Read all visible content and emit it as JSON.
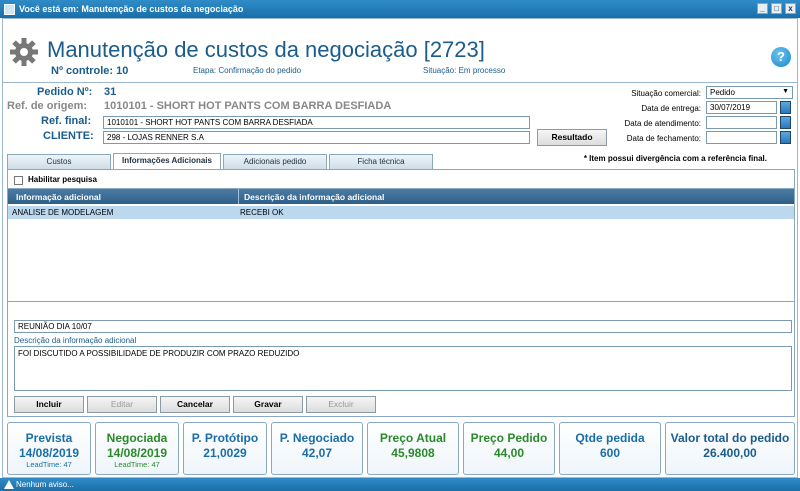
{
  "window": {
    "title": "Você está em: Manutenção de custos da negociação",
    "controls": [
      "_",
      "□",
      "x"
    ]
  },
  "header": {
    "title": "Manutenção de custos da negociação [2723]",
    "controle_label": "Nº controle:",
    "controle_value": "10",
    "etapa_label": "Etapa:",
    "etapa_value": "Confirmação do pedido",
    "situacao_label": "Situação:",
    "situacao_value": "Em processo"
  },
  "form": {
    "pedido_label": "Pedido Nº:",
    "pedido_value": "31",
    "ref_origem_label": "Ref. de origem:",
    "ref_origem_value": "1010101 - SHORT HOT PANTS COM BARRA DESFIADA",
    "ref_final_label": "Ref. final:",
    "ref_final_value": "1010101 - SHORT HOT PANTS COM BARRA DESFIADA",
    "cliente_label": "CLIENTE:",
    "cliente_value": "298 - LOJAS RENNER S.A",
    "resultado_button": "Resultado",
    "situacao_comercial_label": "Situação comercial:",
    "situacao_comercial_value": "Pedido",
    "data_entrega_label": "Data de entrega:",
    "data_entrega_value": "30/07/2019",
    "data_atendimento_label": "Data de atendimento:",
    "data_atendimento_value": "",
    "data_fechamento_label": "Data de fechamento:",
    "data_fechamento_value": ""
  },
  "tabs": [
    {
      "label": "Custos"
    },
    {
      "label": "Informações Adicionais"
    },
    {
      "label": "Adicionais pedido"
    },
    {
      "label": "Ficha técnica"
    }
  ],
  "note": "* Item possui divergência com a referência final.",
  "panel": {
    "habilitar_label": "Habilitar pesquisa",
    "columns": [
      "Informação adicional",
      "Descrição da informação adicional"
    ],
    "rows": [
      {
        "info": "ANALISE DE MODELAGEM",
        "desc": "RECEBI OK"
      }
    ],
    "info_input_value": "REUNIÃO DIA 10/07",
    "desc_label": "Descrição da informação adicional",
    "desc_value": "FOI DISCUTIDO A POSSIBILIDADE DE PRODUZIR COM PRAZO REDUZIDO",
    "buttons": [
      "Incluir",
      "Editar",
      "Cancelar",
      "Gravar",
      "Excluir"
    ]
  },
  "cards": {
    "prevista_title": "Prevista",
    "prevista_value": "14/08/2019",
    "prevista_lead": "LeadTime: 47",
    "negociada_title": "Negociada",
    "negociada_value": "14/08/2019",
    "negociada_lead": "LeadTime: 47",
    "prototipo_title": "P. Protótipo",
    "prototipo_value": "21,0029",
    "negociado_title": "P. Negociado",
    "negociado_value": "42,07",
    "preco_atual_title": "Preço Atual",
    "preco_atual_value": "45,9808",
    "preco_pedido_title": "Preço Pedido",
    "preco_pedido_value": "44,00",
    "qtde_title": "Qtde pedida",
    "qtde_value": "600",
    "valor_total_title": "Valor total do pedido",
    "valor_total_value": "26.400,00"
  },
  "status": {
    "text": "Nenhum aviso..."
  },
  "colors": {
    "titlebar": "#1a6ea8",
    "accent_blue": "#1a5c8c",
    "green": "#2a8a2a",
    "selected_row": "#bcd8ef"
  }
}
